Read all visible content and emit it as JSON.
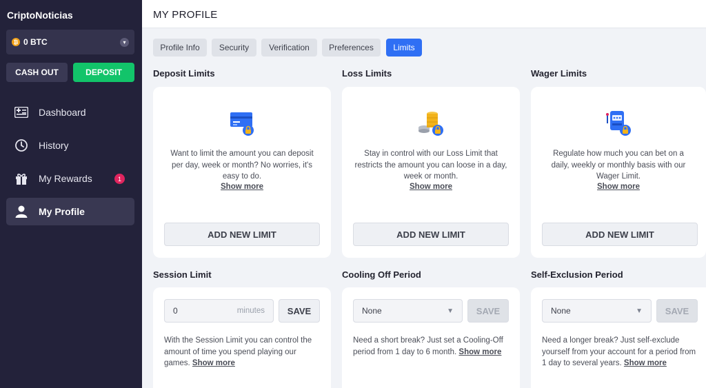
{
  "sidebar": {
    "brand": "CriptoNoticias",
    "wallet": {
      "coin_symbol": "₿",
      "amount": "0 BTC"
    },
    "cash_out_label": "CASH OUT",
    "deposit_label": "DEPOSIT",
    "nav": [
      {
        "label": "Dashboard",
        "icon": "dashboard-icon"
      },
      {
        "label": "History",
        "icon": "history-icon"
      },
      {
        "label": "My Rewards",
        "icon": "gift-icon",
        "badge": "1"
      },
      {
        "label": "My Profile",
        "icon": "user-icon",
        "active": true
      }
    ]
  },
  "header": {
    "title": "MY PROFILE"
  },
  "tabs": [
    {
      "label": "Profile Info"
    },
    {
      "label": "Security"
    },
    {
      "label": "Verification"
    },
    {
      "label": "Preferences"
    },
    {
      "label": "Limits",
      "active": true
    }
  ],
  "limits": [
    {
      "title": "Deposit Limits",
      "icon": "credit-card-lock-icon",
      "description": "Want to limit the amount you can deposit per day, week or month? No worries, it's easy to do.",
      "show_more": "Show more",
      "button": "ADD NEW LIMIT"
    },
    {
      "title": "Loss Limits",
      "icon": "coins-lock-icon",
      "description": "Stay in control with our Loss Limit that restricts the amount you can loose in a day, week or month.",
      "show_more": "Show more",
      "button": "ADD NEW LIMIT"
    },
    {
      "title": "Wager Limits",
      "icon": "slot-machine-lock-icon",
      "description": "Regulate how much you can bet on a daily, weekly or monthly basis with our Wager Limit.",
      "show_more": "Show more",
      "button": "ADD NEW LIMIT"
    }
  ],
  "session": {
    "title": "Session Limit",
    "value": "0",
    "suffix": "minutes",
    "save": "SAVE",
    "description": "With the Session Limit you can control the amount of time you spend playing our games.",
    "show_more": "Show more"
  },
  "cooling": {
    "title": "Cooling Off Period",
    "selected": "None",
    "save": "SAVE",
    "description": "Need a short break? Just set a Cooling-Off period from 1 day to 6 month.",
    "show_more": "Show more"
  },
  "exclusion": {
    "title": "Self-Exclusion Period",
    "selected": "None",
    "save": "SAVE",
    "description": "Need a longer break? Just self-exclude yourself from your account for a period from 1 day to several years.",
    "show_more": "Show more"
  },
  "colors": {
    "accent": "#2f6ff4",
    "deposit": "#12c46a",
    "sidebar": "#23223a",
    "badge": "#e0245e"
  }
}
